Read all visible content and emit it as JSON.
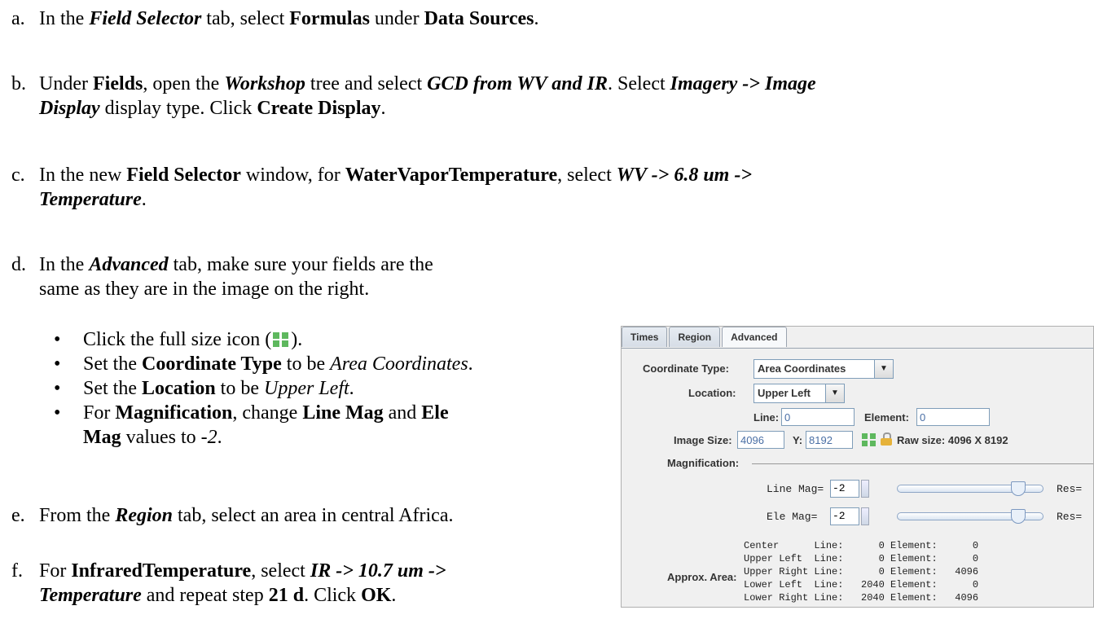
{
  "steps": {
    "a": {
      "letter": "a.",
      "t1": "In the ",
      "t2": "Field Selector",
      "t3": " tab, select ",
      "t4": "Formulas",
      "t5": " under ",
      "t6": "Data Sources",
      "t7": "."
    },
    "b": {
      "letter": "b.",
      "t1": "Under ",
      "t2": "Fields",
      "t3": ", open the ",
      "t4": "Workshop",
      "t5": " tree and select ",
      "t6": "GCD from WV and IR",
      "t7": ". Select ",
      "t8": "Imagery -> Image",
      "t9": "Display",
      "t10": " display type. Click ",
      "t11": "Create Display",
      "t12": "."
    },
    "c": {
      "letter": "c.",
      "t1": "In the new ",
      "t2": "Field Selector",
      "t3": " window, for ",
      "t4": "WaterVaporTemperature",
      "t5": ", select ",
      "t6": "WV -> 6.8 um ->",
      "t7": "Temperature",
      "t8": "."
    },
    "d": {
      "letter": "d.",
      "t1": "In the ",
      "t2": "Advanced",
      "t3": " tab, make sure your fields are the",
      "t4": "same as they are in the image on the right."
    },
    "e": {
      "letter": "e.",
      "t1": "From the ",
      "t2": "Region",
      "t3": " tab, select an area in central Africa."
    },
    "f": {
      "letter": "f.",
      "t1": "For ",
      "t2": "InfraredTemperature",
      "t3": ", select ",
      "t4": "IR -> 10.7 um ->",
      "t5": "Temperature",
      "t6": " and repeat step ",
      "t7": "21 d",
      "t8": ". Click ",
      "t9": "OK",
      "t10": "."
    }
  },
  "bullets": {
    "b1": {
      "t1": "Click the full size icon (",
      "t2": ")."
    },
    "b2": {
      "t1": "Set the ",
      "t2": "Coordinate Type",
      "t3": " to be ",
      "t4": "Area Coordinates",
      "t5": "."
    },
    "b3": {
      "t1": "Set the ",
      "t2": "Location",
      "t3": " to be ",
      "t4": "Upper Left",
      "t5": "."
    },
    "b4": {
      "t1": "For ",
      "t2": "Magnification",
      "t3": ", change ",
      "t4": "Line Mag",
      "t5": " and ",
      "t6": "Ele",
      "t7": "Mag",
      "t8": " values to ",
      "t9": "-2",
      "t10": "."
    }
  },
  "panel": {
    "tabs": [
      "Times",
      "Region",
      "Advanced"
    ],
    "coord_type_label": "Coordinate Type:",
    "coord_type_value": "Area Coordinates",
    "location_label": "Location:",
    "location_value": "Upper Left",
    "line_label": "Line:",
    "line_value": "0",
    "element_label": "Element:",
    "element_value": "0",
    "image_size_label": "Image Size:",
    "image_x_value": "4096",
    "image_y_label": "Y:",
    "image_y_value": "8192",
    "raw_size_label": "Raw size: 4096 X 8192",
    "magnification_label": "Magnification:",
    "line_mag_label": "Line Mag=",
    "line_mag_value": "-2",
    "ele_mag_label": "Ele  Mag=",
    "ele_mag_value": "-2",
    "res_label": "Res=",
    "approx_area_label": "Approx. Area:",
    "area_rows": [
      "Center      Line:      0 Element:      0",
      "Upper Left  Line:      0 Element:      0",
      "Upper Right Line:      0 Element:   4096",
      "Lower Left  Line:   2040 Element:      0",
      "Lower Right Line:   2040 Element:   4096"
    ]
  },
  "colors": {
    "icon_green": "#5eb85e",
    "field_text": "#4a6fa5"
  }
}
